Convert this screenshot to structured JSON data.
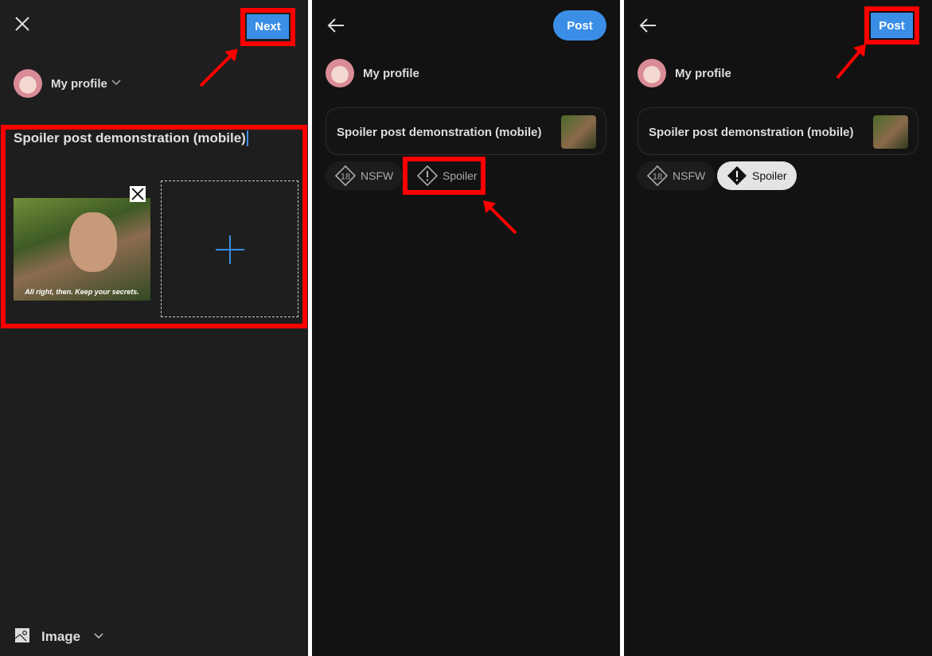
{
  "colors": {
    "accent": "#3a8ee6",
    "highlight": "#ff0000",
    "panel1_bg": "#1e1e1e",
    "panel_bg": "#121212"
  },
  "panel1": {
    "close_icon": "close-icon",
    "next_label": "Next",
    "profile": "My profile",
    "title_input": "Spoiler post demonstration (mobile)",
    "image_caption": "All right, then. Keep your secrets.",
    "add_icon": "plus-icon",
    "bottom_type": "Image"
  },
  "panel2": {
    "back_icon": "arrow-left-icon",
    "post_label": "Post",
    "profile": "My profile",
    "post_title": "Spoiler post demonstration (mobile)",
    "tags": [
      {
        "label": "NSFW",
        "icon": "18-diamond-icon",
        "selected": false
      },
      {
        "label": "Spoiler",
        "icon": "exclamation-diamond-icon",
        "selected": false
      }
    ]
  },
  "panel3": {
    "back_icon": "arrow-left-icon",
    "post_label": "Post",
    "profile": "My profile",
    "post_title": "Spoiler post demonstration (mobile)",
    "tags": [
      {
        "label": "NSFW",
        "icon": "18-diamond-icon",
        "selected": false
      },
      {
        "label": "Spoiler",
        "icon": "exclamation-diamond-icon",
        "selected": true
      }
    ]
  }
}
